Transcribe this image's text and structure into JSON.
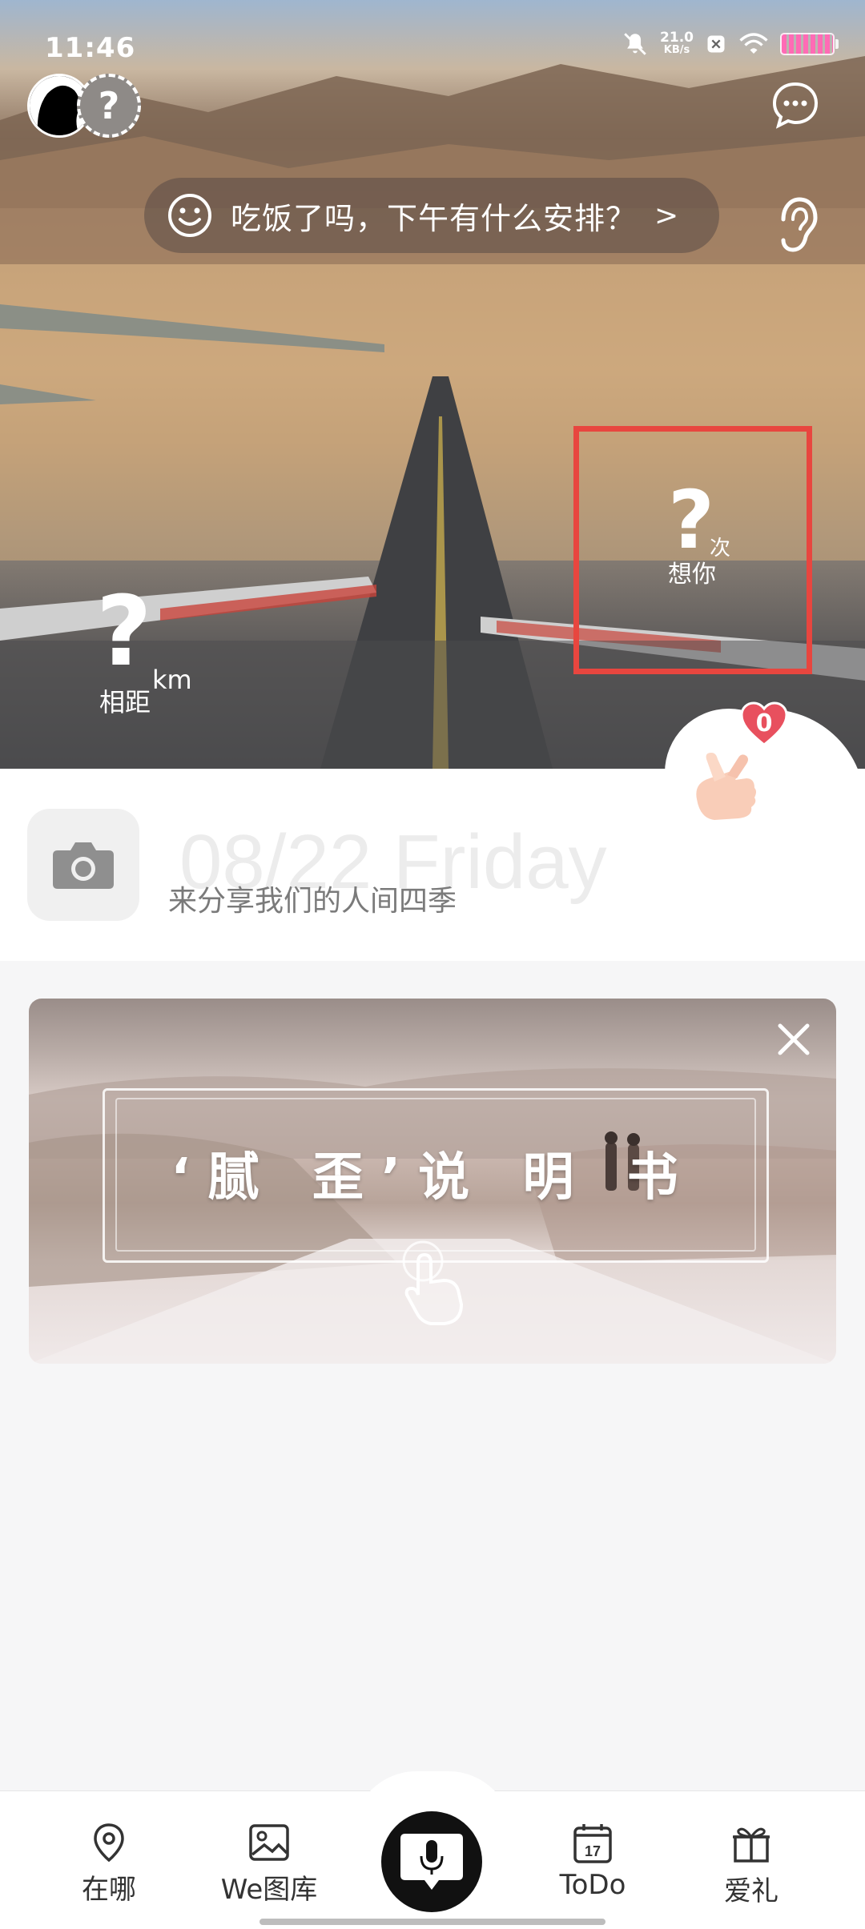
{
  "status_bar": {
    "time": "11:46",
    "net_speed_value": "21.0",
    "net_speed_unit": "KB/s"
  },
  "hero": {
    "greeting_text": "吃饭了吗，下午有什么安排？",
    "greeting_arrow": ">",
    "avatar_placeholder": "?",
    "distance_value": "?",
    "distance_unit": "km",
    "distance_label": "相距",
    "miss_value": "?",
    "miss_unit": "次",
    "miss_label": "想你",
    "heart_badge_count": "0"
  },
  "post": {
    "date_watermark": "08/22 Friday",
    "share_text": "来分享我们的人间四季"
  },
  "banner": {
    "title": "‘腻 歪’说 明 书"
  },
  "nav": {
    "items": [
      {
        "label": "在哪",
        "icon": "location-pin-icon"
      },
      {
        "label": "We图库",
        "icon": "image-icon"
      },
      {
        "label": "",
        "icon": "microphone-icon"
      },
      {
        "label": "ToDo",
        "icon": "calendar-icon"
      },
      {
        "label": "爱礼",
        "icon": "gift-icon"
      }
    ],
    "calendar_day": "17"
  },
  "colors": {
    "highlight_border": "#e8463f",
    "badge": "#e8505e"
  }
}
